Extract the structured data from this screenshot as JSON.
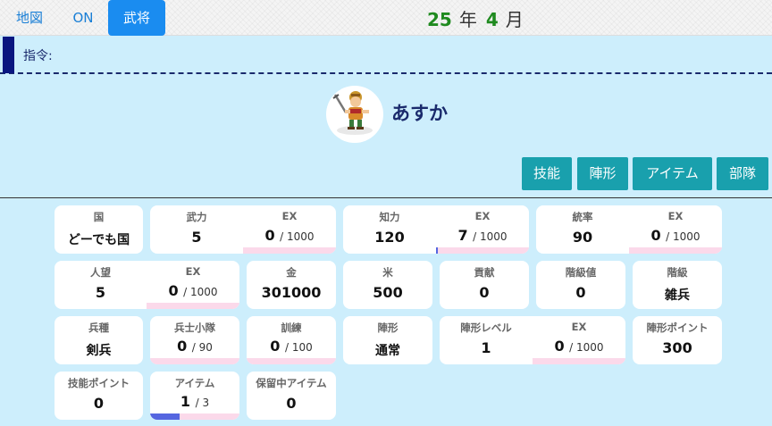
{
  "nav": [
    {
      "label": "地図",
      "active": false
    },
    {
      "label": "ON",
      "active": false
    },
    {
      "label": "武将",
      "active": true
    }
  ],
  "date": {
    "year": "25",
    "year_unit": "年",
    "month": "4",
    "month_unit": "月"
  },
  "command": {
    "label": "指令:"
  },
  "general": {
    "name": "あすか",
    "avatar_icon": "warrior-sprite-icon"
  },
  "actions": [
    "技能",
    "陣形",
    "アイテム",
    "部隊"
  ],
  "stats": {
    "country": {
      "label": "国",
      "value": "どーでも国"
    },
    "power": {
      "label": "武力",
      "value": "5",
      "ex_label": "EX",
      "ex": "0",
      "ex_max": "/ 1000",
      "ex_progress": 0
    },
    "intellect": {
      "label": "知力",
      "value": "120",
      "ex_label": "EX",
      "ex": "7",
      "ex_max": "/ 1000",
      "ex_progress": 0.007
    },
    "leadership": {
      "label": "統率",
      "value": "90",
      "ex_label": "EX",
      "ex": "0",
      "ex_max": "/ 1000",
      "ex_progress": 0
    },
    "popularity": {
      "label": "人望",
      "value": "5",
      "ex_label": "EX",
      "ex": "0",
      "ex_max": "/ 1000",
      "ex_progress": 0
    },
    "gold": {
      "label": "金",
      "value": "301000"
    },
    "rice": {
      "label": "米",
      "value": "500"
    },
    "contribution": {
      "label": "貢献",
      "value": "0"
    },
    "rank_value": {
      "label": "階級値",
      "value": "0"
    },
    "rank": {
      "label": "階級",
      "value": "雑兵"
    },
    "troop_type": {
      "label": "兵種",
      "value": "剣兵"
    },
    "squad": {
      "label": "兵士小隊",
      "value": "0",
      "max": "/ 90",
      "progress": 0
    },
    "training": {
      "label": "訓練",
      "value": "0",
      "max": "/ 100",
      "progress": 0
    },
    "formation": {
      "label": "陣形",
      "value": "通常"
    },
    "formation_level": {
      "label": "陣形レベル",
      "value": "1",
      "ex_label": "EX",
      "ex": "0",
      "ex_max": "/ 1000",
      "ex_progress": 0
    },
    "formation_points": {
      "label": "陣形ポイント",
      "value": "300"
    },
    "skill_points": {
      "label": "技能ポイント",
      "value": "0"
    },
    "items": {
      "label": "アイテム",
      "value": "1",
      "max": "/ 3",
      "progress": 0.333
    },
    "stored_items": {
      "label": "保留中アイテム",
      "value": "0"
    }
  },
  "colors": {
    "accent": "#1a8cf0",
    "action": "#19a0ad",
    "progress_track": "#fbd9ea",
    "progress_fill": "#5566e0",
    "date_number": "#1f8a1f"
  }
}
